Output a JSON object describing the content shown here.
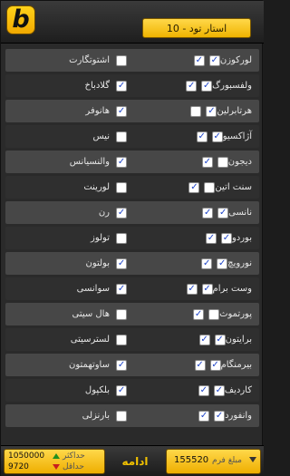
{
  "header": {
    "logo_letter": "b",
    "tab_label": "استار تود - 10"
  },
  "rows": [
    {
      "home": "لورکوزن",
      "home_checked": true,
      "away": "اشتوتگارت",
      "away_checked": false,
      "mid_checked": true
    },
    {
      "home": "ولفسبورگ",
      "home_checked": true,
      "away": "گلادباخ",
      "away_checked": true,
      "mid_checked": true
    },
    {
      "home": "هرتابرلین",
      "home_checked": true,
      "away": "هانوفر",
      "away_checked": true,
      "mid_checked": false
    },
    {
      "home": "آژاکسیو",
      "home_checked": true,
      "away": "نیس",
      "away_checked": false,
      "mid_checked": true
    },
    {
      "home": "دیجون",
      "home_checked": false,
      "away": "والنسیانس",
      "away_checked": true,
      "mid_checked": true
    },
    {
      "home": "سنت اتین",
      "home_checked": false,
      "away": "لورینت",
      "away_checked": false,
      "mid_checked": true
    },
    {
      "home": "نانسی",
      "home_checked": true,
      "away": "رن",
      "away_checked": true,
      "mid_checked": true
    },
    {
      "home": "بوردو",
      "home_checked": true,
      "away": "تولوز",
      "away_checked": false,
      "mid_checked": true
    },
    {
      "home": "نورویچ",
      "home_checked": true,
      "away": "بولتون",
      "away_checked": true,
      "mid_checked": true
    },
    {
      "home": "وست برام",
      "home_checked": true,
      "away": "سوانسی",
      "away_checked": true,
      "mid_checked": true
    },
    {
      "home": "پورتموث",
      "home_checked": false,
      "away": "هال سیتی",
      "away_checked": false,
      "mid_checked": true
    },
    {
      "home": "برایتون",
      "home_checked": true,
      "away": "لسترسیتی",
      "away_checked": false,
      "mid_checked": true
    },
    {
      "home": "بیرمنگام",
      "home_checked": true,
      "away": "ساوتهمتون",
      "away_checked": true,
      "mid_checked": true
    },
    {
      "home": "کاردیف",
      "home_checked": true,
      "away": "بلکپول",
      "away_checked": true,
      "mid_checked": true
    },
    {
      "home": "وانفورد",
      "home_checked": true,
      "away": "بارنزلی",
      "away_checked": false,
      "mid_checked": true
    }
  ],
  "footer": {
    "max_value": "1050000",
    "max_label": "حداکثر",
    "min_value": "9720",
    "min_label": "حداقل",
    "continue_label": "ادامه",
    "stake_value": "155520",
    "stake_label": "مبلغ فرم"
  },
  "colors": {
    "accent": "#f2b400",
    "check": "#1f45c9",
    "row_light": "#474747",
    "row_dark": "#2f2f2f"
  }
}
